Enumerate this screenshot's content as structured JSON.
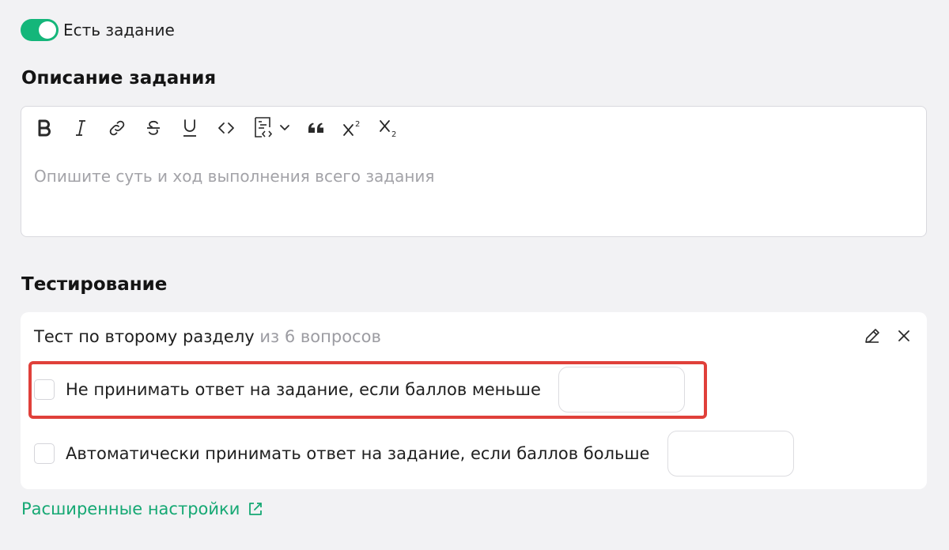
{
  "task_toggle": {
    "label": "Есть задание",
    "checked": true,
    "color": "#14b67a"
  },
  "description": {
    "title": "Описание задания",
    "placeholder": "Опишите суть и ход выполнения всего задания",
    "toolbar": [
      {
        "name": "bold-button",
        "icon": "bold-icon"
      },
      {
        "name": "italic-button",
        "icon": "italic-icon"
      },
      {
        "name": "link-button",
        "icon": "link-icon"
      },
      {
        "name": "strikethrough-button",
        "icon": "strikethrough-icon"
      },
      {
        "name": "underline-button",
        "icon": "underline-icon"
      },
      {
        "name": "inline-code-button",
        "icon": "code-icon"
      },
      {
        "name": "code-block-dropdown",
        "icon": "code-block-icon"
      },
      {
        "name": "quote-button",
        "icon": "quote-icon"
      },
      {
        "name": "superscript-button",
        "icon": "superscript-icon"
      },
      {
        "name": "subscript-button",
        "icon": "subscript-icon"
      }
    ]
  },
  "testing": {
    "title": "Тестирование",
    "test_name": "Тест по второму разделу",
    "test_meta": "из 6 вопросов",
    "options": [
      {
        "label": "Не принимать ответ на задание, если баллов меньше",
        "checked": false,
        "value": "",
        "highlighted": true
      },
      {
        "label": "Автоматически принимать ответ на задание, если баллов больше",
        "checked": false,
        "value": "",
        "highlighted": false
      }
    ]
  },
  "advanced_link": {
    "label": "Расширенные настройки",
    "color": "#15a873"
  }
}
